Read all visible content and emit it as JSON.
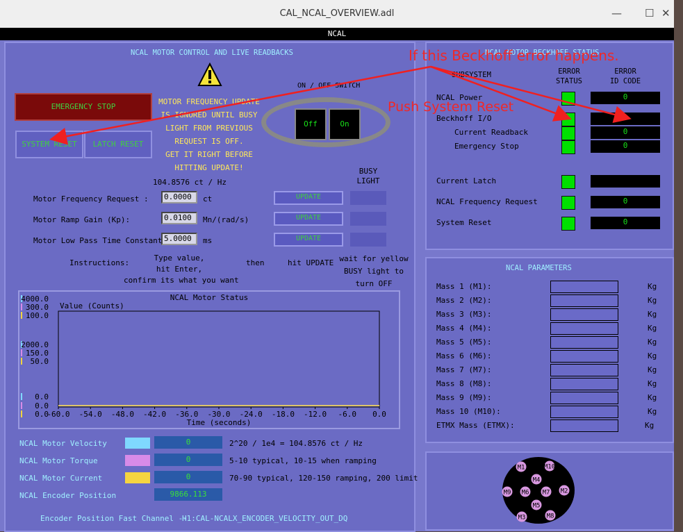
{
  "window": {
    "title": "CAL_NCAL_OVERVIEW.adl",
    "minimize": "—",
    "maximize": "☐",
    "close": "✕"
  },
  "header": {
    "title": "NCAL"
  },
  "control": {
    "title": "NCAL MOTOR CONTROL AND LIVE READBACKS",
    "emergency_stop": "EMERGENCY STOP",
    "system_reset": "SYSTEM RESET",
    "latch_reset": "LATCH RESET",
    "warning_lines": [
      "MOTOR FREQUENCY UPDATE",
      "IS IGNORED UNTIL BUSY",
      "LIGHT FROM PREVIOUS",
      "REQUEST IS OFF.",
      "GET IT RIGHT BEFORE",
      "HITTING UPDATE!"
    ],
    "switch_title": "ON / OFF SWITCH",
    "off": "Off",
    "on": "On",
    "conversion": "104.8576 ct / Hz",
    "busy_title": [
      "BUSY",
      "LIGHT"
    ],
    "update": "UPDATE",
    "rows": [
      {
        "label": "Motor Frequency Request :",
        "value": "0.0000",
        "unit": "ct"
      },
      {
        "label": "Motor Ramp Gain (Kp):",
        "value": "0.0100",
        "unit": "Mn/(rad/s)"
      },
      {
        "label": "Motor Low Pass Time Constant:",
        "value": "5.0000",
        "unit": "ms"
      }
    ],
    "instructions": {
      "label": "Instructions:",
      "step1": [
        "Type value,",
        "hit Enter,",
        "confirm its what you want"
      ],
      "then": "then",
      "step2": "hit UPDATE",
      "step3": [
        "wait for yellow",
        "BUSY light to",
        "turn OFF"
      ]
    }
  },
  "chart_data": {
    "type": "line",
    "title": "NCAL Motor Status",
    "ylabel": "Value (Counts)",
    "xlabel": "Time (seconds)",
    "x_ticks": [
      "-60.0",
      "-54.0",
      "-48.0",
      "-42.0",
      "-36.0",
      "-30.0",
      "-24.0",
      "-18.0",
      "-12.0",
      "-6.0",
      "0.0"
    ],
    "xlim": [
      -60,
      0
    ],
    "y_axes": [
      {
        "color": "#7fd8ff",
        "max": "4000.0",
        "mid": "2000.0",
        "min": "0.0"
      },
      {
        "color": "#d88be8",
        "max": "300.0",
        "mid": "150.0",
        "min": "0.0"
      },
      {
        "color": "#f0d440",
        "max": "100.0",
        "mid": "50.0",
        "min": "0.0"
      }
    ],
    "series": [
      {
        "color": "#7fd8ff",
        "x": [
          -60,
          0
        ],
        "y": [
          0,
          0
        ]
      },
      {
        "color": "#d88be8",
        "x": [
          -60,
          0
        ],
        "y": [
          0,
          0
        ]
      },
      {
        "color": "#f0d440",
        "x": [
          -60,
          0
        ],
        "y": [
          0,
          0
        ]
      }
    ]
  },
  "readbacks": [
    {
      "label": "NCAL Motor Velocity",
      "color": "#7fd8ff",
      "value": "0",
      "note": "2^20 / 1e4 = 104.8576 ct / Hz"
    },
    {
      "label": "NCAL Motor Torque",
      "color": "#d88be8",
      "value": "0",
      "note": "5-10 typical, 10-15 when ramping"
    },
    {
      "label": "NCAL Motor Current",
      "color": "#f5d440",
      "value": "0",
      "note": "70-90 typical, 120-150 ramping, 200 limit"
    },
    {
      "label": "NCAL Encoder Position",
      "value": "9866.113"
    }
  ],
  "encoder_fast": {
    "label": "Encoder Position Fast Channel --",
    "channel": "H1:CAL-NCALX_ENCODER_VELOCITY_OUT_DQ"
  },
  "beckhoff": {
    "title": "NCAL MOTOR BECKHOFF STATUS",
    "col_subsystem": "SUBSYSTEM",
    "col_status": [
      "ERROR",
      "STATUS"
    ],
    "col_code": [
      "ERROR",
      "ID CODE"
    ],
    "rows": [
      {
        "label": "NCAL Power",
        "code": "0"
      },
      {
        "label": "Beckhoff I/O",
        "code": "0"
      },
      {
        "label": "Current Readback",
        "code": "0"
      },
      {
        "label": "Emergency Stop",
        "code": "0"
      },
      {
        "label": "Current Latch",
        "code": ""
      },
      {
        "label": "NCAL Frequency Request",
        "code": "0"
      },
      {
        "label": "System Reset",
        "code": "0"
      }
    ]
  },
  "parameters": {
    "title": "NCAL PARAMETERS",
    "unit": "Kg",
    "masses": [
      "Mass 1 (M1):",
      "Mass 2 (M2):",
      "Mass 3 (M3):",
      "Mass 4 (M4):",
      "Mass 5 (M5):",
      "Mass 6 (M6):",
      "Mass 7 (M7):",
      "Mass 8 (M8):",
      "Mass 9 (M9):",
      "Mass 10 (M10):",
      "ETMX Mass (ETMX):"
    ]
  },
  "rotor": {
    "labels": [
      "M1",
      "M10",
      "M4",
      "M9",
      "M6",
      "M7",
      "M2",
      "M5",
      "M3",
      "M8"
    ]
  },
  "annotations": {
    "beckhoff_error": "If this Beckhoff error happens.",
    "push_reset": "Push System Reset"
  }
}
